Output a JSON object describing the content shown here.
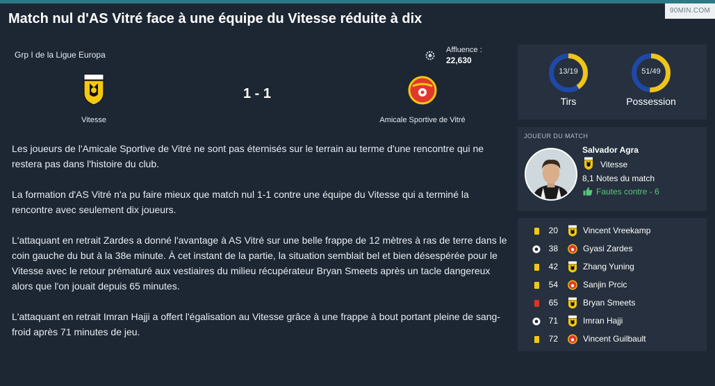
{
  "site": {
    "brand": "90MIN.COM"
  },
  "headline": "Match nul d'AS Vitré face à une équipe du Vitesse réduite à dix",
  "match": {
    "competition": "Grp I de la Ligue Europa",
    "attendance_label": "Affluence :",
    "attendance_value": "22,630",
    "score": "1 - 1",
    "home_team": "Vitesse",
    "away_team": "Amicale Sportive de Vitré"
  },
  "article": {
    "paragraphs": [
      "Les joueurs de l'Amicale Sportive de Vitré ne sont pas éternisés sur le terrain au terme d'une rencontre qui ne restera pas dans l'histoire du club.",
      "La formation d'AS Vitré n'a pu faire mieux que match nul 1-1 contre une équipe du Vitesse qui a terminé la rencontre avec seulement dix joueurs.",
      "L'attaquant en retrait Zardes a donné l'avantage à AS Vitré sur une belle frappe de 12 mètres à ras de terre dans le coin gauche du but à la 38e minute. À cet instant de la partie, la situation semblait bel et bien désespérée pour le Vitesse avec le retour prématuré aux vestiaires du milieu récupérateur Bryan Smeets après un tacle dangereux alors que l'on jouait depuis 65 minutes.",
      "L'attaquant en retrait Imran Hajji a offert l'égalisation au Vitesse grâce à une frappe à bout portant pleine de sang-froid après 71 minutes de jeu."
    ]
  },
  "stats": {
    "shots": {
      "value": "13/19",
      "label": "Tirs",
      "home": 13,
      "away": 19
    },
    "possession": {
      "value": "51/49",
      "label": "Possession",
      "home": 51,
      "away": 49
    }
  },
  "motm": {
    "title": "JOUEUR DU MATCH",
    "name": "Salvador Agra",
    "club": "Vitesse",
    "rating": "8,1 Notes du match",
    "fouls": "Fautes contre - 6"
  },
  "events": [
    {
      "icon": "yellow-card",
      "minute": "20",
      "team": "home",
      "player": "Vincent Vreekamp"
    },
    {
      "icon": "goal-ball",
      "minute": "38",
      "team": "away",
      "player": "Gyasi Zardes"
    },
    {
      "icon": "yellow-card",
      "minute": "42",
      "team": "home",
      "player": "Zhang Yuning"
    },
    {
      "icon": "yellow-card",
      "minute": "54",
      "team": "away",
      "player": "Sanjin Prcic"
    },
    {
      "icon": "red-card",
      "minute": "65",
      "team": "home",
      "player": "Bryan Smeets"
    },
    {
      "icon": "goal-ball",
      "minute": "71",
      "team": "home",
      "player": "Imran Hajji"
    },
    {
      "icon": "yellow-card",
      "minute": "72",
      "team": "away",
      "player": "Vincent Guilbault"
    }
  ],
  "colors": {
    "background": "#1d2633",
    "panel": "#26303e",
    "home_ring": "#f0c419",
    "away_ring": "#1f49a7",
    "accent_green": "#58c67a",
    "yellow_card": "#f2c811",
    "red_card": "#d9342b"
  }
}
